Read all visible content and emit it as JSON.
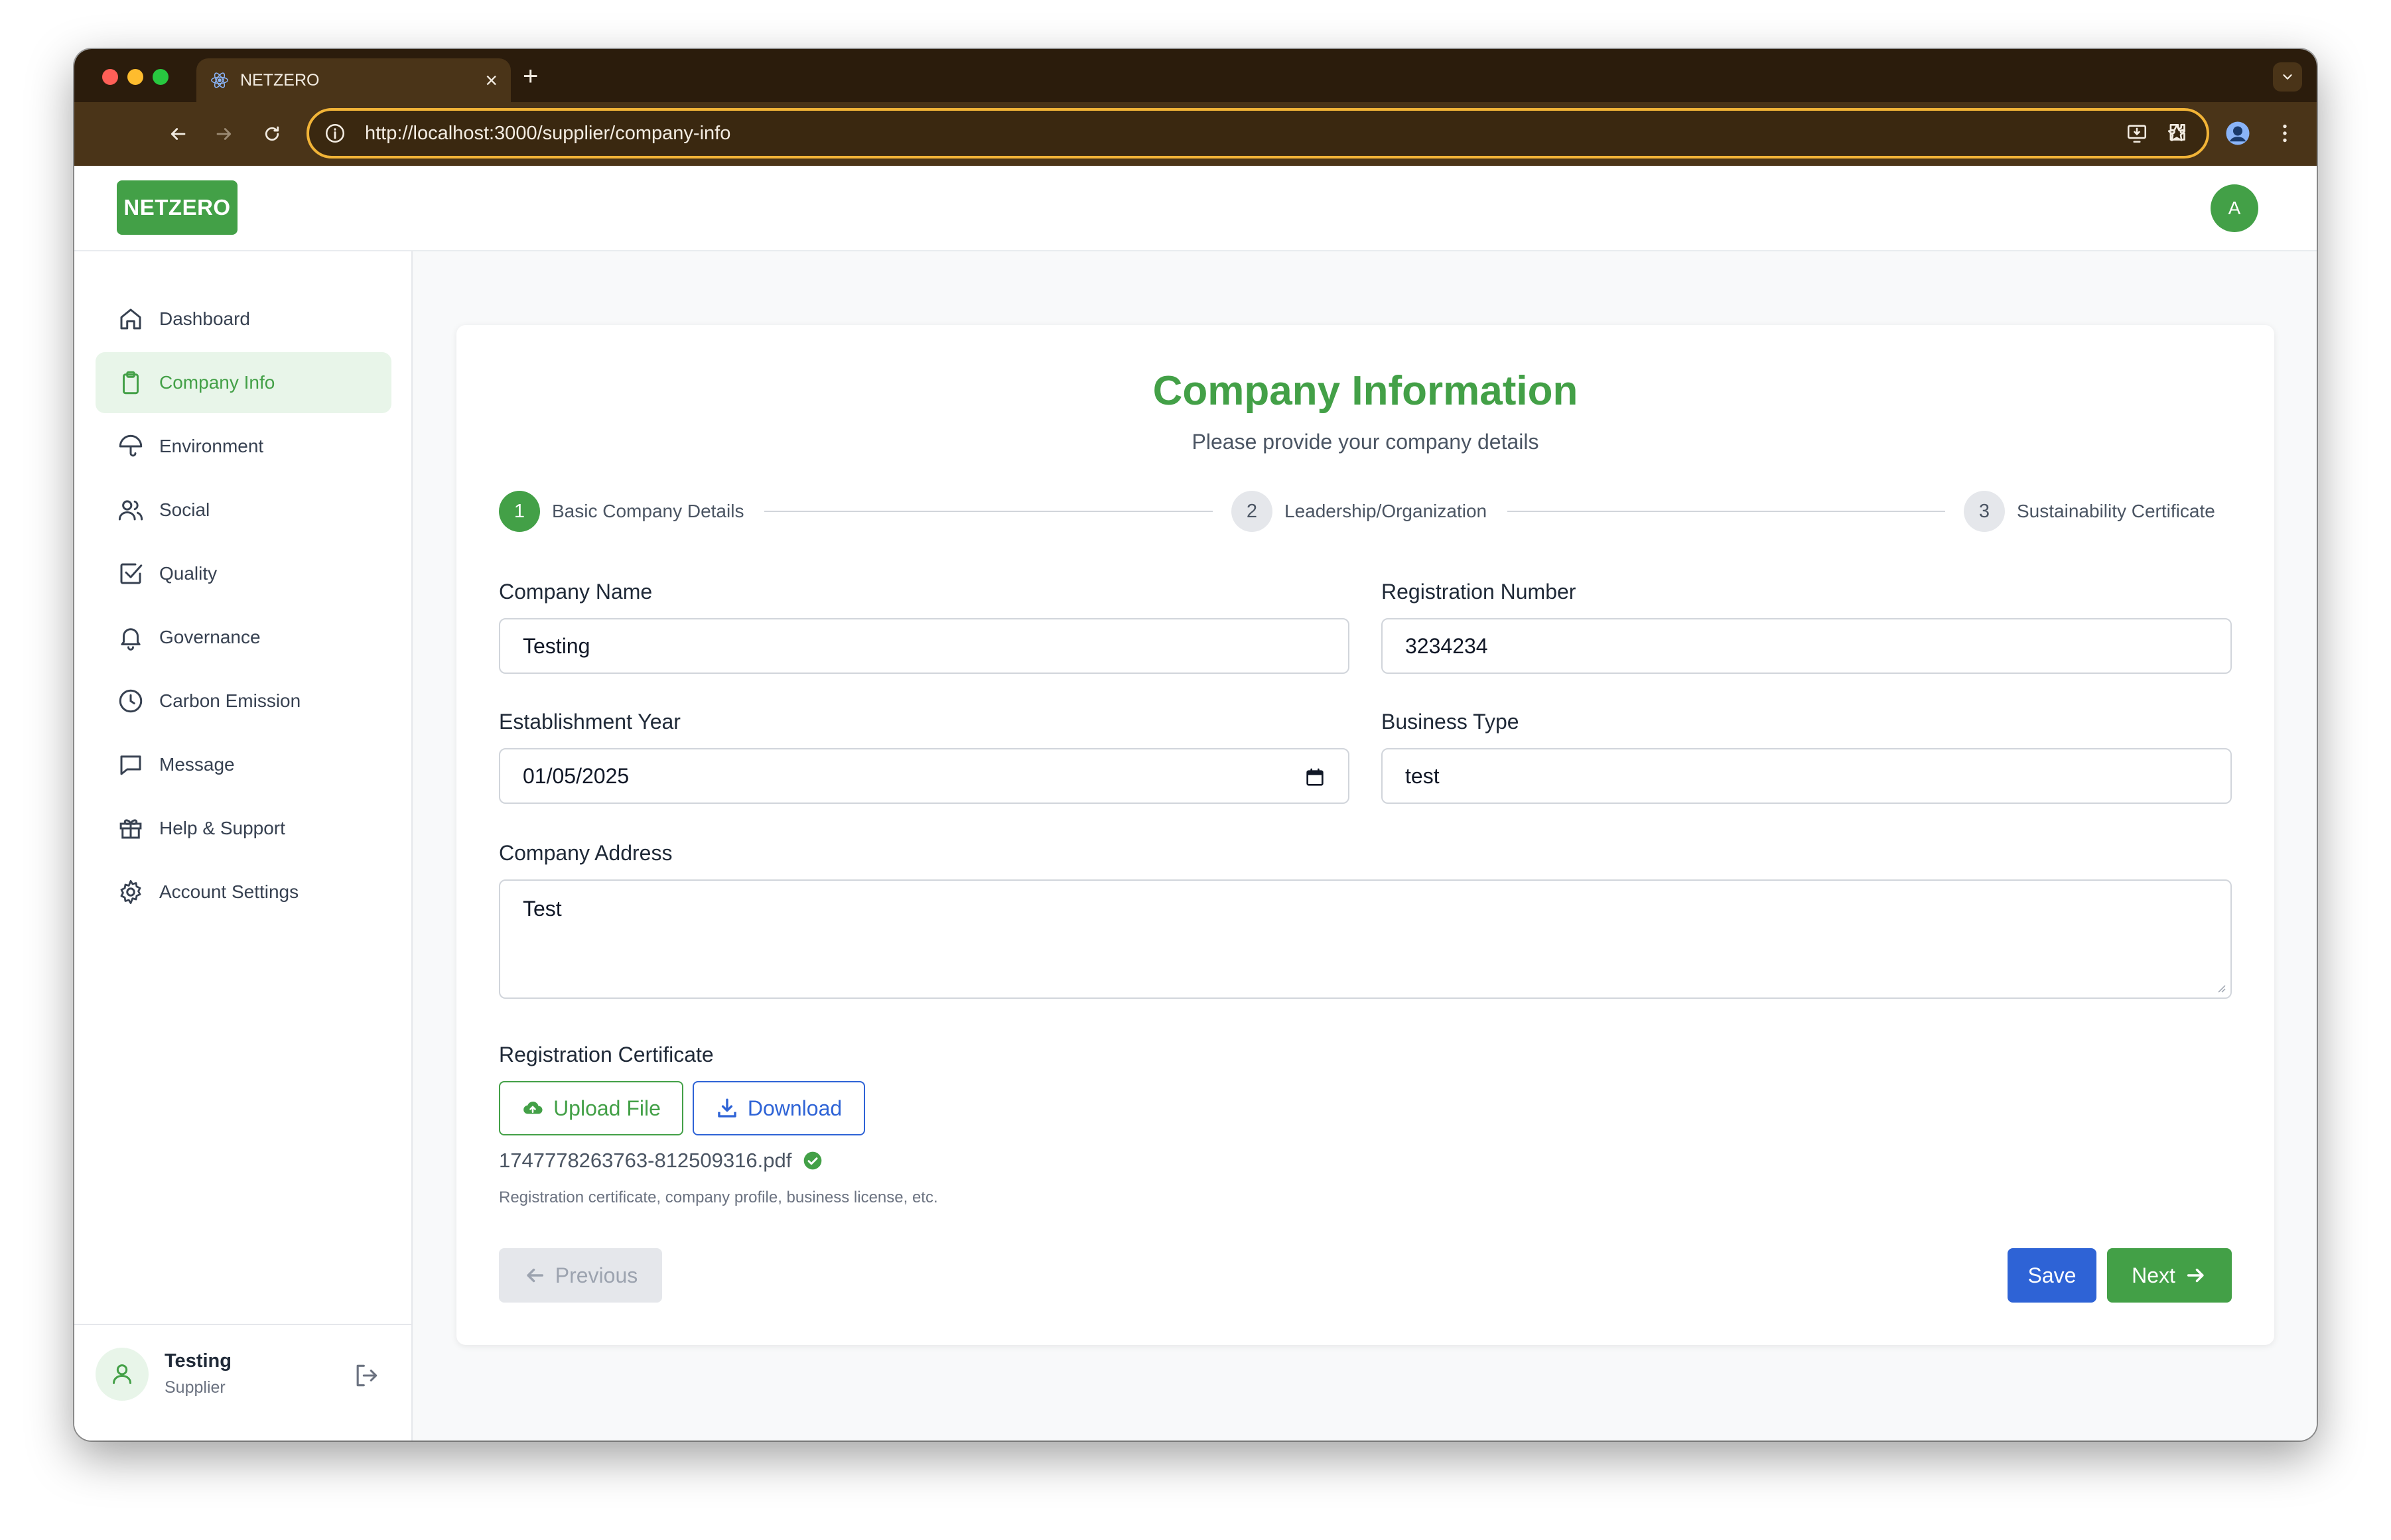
{
  "browser": {
    "tab_title": "NETZERO",
    "url": "http://localhost:3000/supplier/company-info"
  },
  "header": {
    "logo": "NETZERO",
    "avatar_initial": "A"
  },
  "sidebar": {
    "items": [
      {
        "label": "Dashboard",
        "icon": "home-icon"
      },
      {
        "label": "Company Info",
        "icon": "clipboard-icon",
        "active": true
      },
      {
        "label": "Environment",
        "icon": "umbrella-icon"
      },
      {
        "label": "Social",
        "icon": "users-icon"
      },
      {
        "label": "Quality",
        "icon": "check-square-icon"
      },
      {
        "label": "Governance",
        "icon": "bell-icon"
      },
      {
        "label": "Carbon Emission",
        "icon": "clock-icon"
      },
      {
        "label": "Message",
        "icon": "message-icon"
      },
      {
        "label": "Help & Support",
        "icon": "gift-icon"
      },
      {
        "label": "Account Settings",
        "icon": "gear-icon"
      }
    ],
    "user": {
      "name": "Testing",
      "role": "Supplier"
    }
  },
  "form": {
    "title": "Company Information",
    "subtitle": "Please provide your company details",
    "steps": [
      {
        "number": "1",
        "label": "Basic Company Details",
        "active": true
      },
      {
        "number": "2",
        "label": "Leadership/Organization",
        "active": false
      },
      {
        "number": "3",
        "label": "Sustainability Certificate",
        "active": false
      }
    ],
    "fields": {
      "company_name": {
        "label": "Company Name",
        "value": "Testing"
      },
      "registration_number": {
        "label": "Registration Number",
        "value": "3234234"
      },
      "establishment_year": {
        "label": "Establishment Year",
        "value": "01/05/2025"
      },
      "business_type": {
        "label": "Business Type",
        "value": "test"
      },
      "company_address": {
        "label": "Company Address",
        "value": "Test"
      }
    },
    "certificate": {
      "label": "Registration Certificate",
      "upload_label": "Upload File",
      "download_label": "Download",
      "file_name": "1747778263763-812509316.pdf",
      "hint": "Registration certificate, company profile, business license, etc."
    },
    "actions": {
      "previous_label": "Previous",
      "save_label": "Save",
      "next_label": "Next"
    }
  },
  "colors": {
    "brand_green": "#43a047",
    "primary_blue": "#2e63d6",
    "chrome_brown": "#4a3418",
    "address_focus": "#f2b437"
  }
}
